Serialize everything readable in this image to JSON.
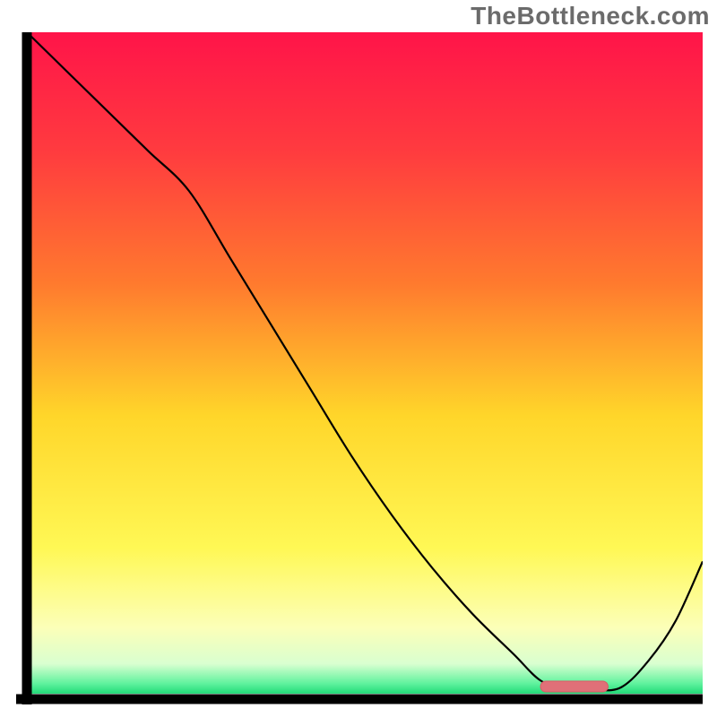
{
  "watermark": "TheBottleneck.com",
  "colors": {
    "axis": "#000000",
    "curve": "#000000",
    "marker_fill": "#e07078",
    "marker_stroke": "#d85c66",
    "gradient_stops": [
      {
        "offset": 0.0,
        "color": "#ff1449"
      },
      {
        "offset": 0.18,
        "color": "#ff3b3f"
      },
      {
        "offset": 0.38,
        "color": "#ff7a2e"
      },
      {
        "offset": 0.58,
        "color": "#ffd62a"
      },
      {
        "offset": 0.78,
        "color": "#fff855"
      },
      {
        "offset": 0.9,
        "color": "#fcffb8"
      },
      {
        "offset": 0.955,
        "color": "#d9ffd0"
      },
      {
        "offset": 0.985,
        "color": "#5ef29d"
      },
      {
        "offset": 1.0,
        "color": "#21d978"
      }
    ]
  },
  "chart_data": {
    "type": "line",
    "title": "",
    "xlabel": "",
    "ylabel": "",
    "xlim": [
      0,
      100
    ],
    "ylim": [
      0,
      100
    ],
    "x": [
      0,
      6,
      12,
      18,
      24,
      30,
      36,
      42,
      48,
      54,
      60,
      66,
      72,
      76,
      80,
      84,
      88,
      92,
      96,
      100
    ],
    "values": [
      100,
      94,
      88,
      82,
      76,
      66,
      56,
      46,
      36,
      27,
      19,
      12,
      6,
      2,
      0.5,
      0.5,
      1,
      5,
      11,
      20
    ],
    "optimum_range_x": [
      76,
      86
    ]
  }
}
